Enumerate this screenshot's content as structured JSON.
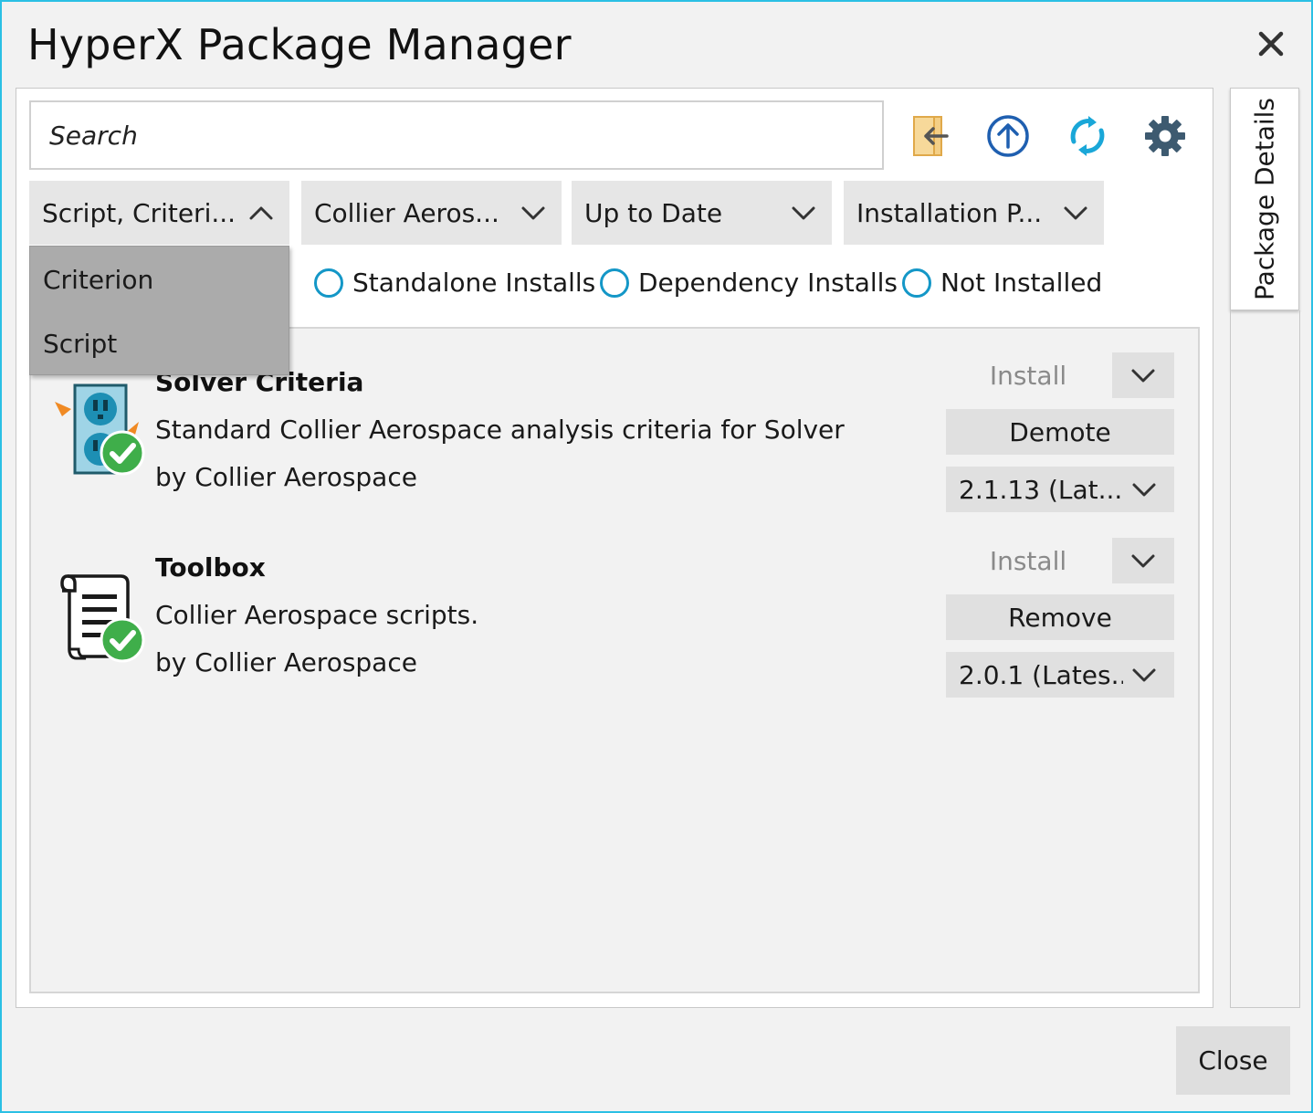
{
  "window": {
    "title": "HyperX Package Manager"
  },
  "search": {
    "placeholder": "Search"
  },
  "toolbar": {
    "icons": [
      "import-icon",
      "upload-icon",
      "refresh-icon",
      "settings-icon"
    ],
    "colors": {
      "import": "#f0c070",
      "upload": "#1f5fb0",
      "refresh": "#1aa7d8",
      "settings": "#3d5a70"
    }
  },
  "filters": {
    "type": "Script, Criteri...",
    "publisher": "Collier Aeros...",
    "status": "Up to Date",
    "installation": "Installation P..."
  },
  "type_dropdown": {
    "items": [
      "Criterion",
      "Script"
    ]
  },
  "radios": {
    "partial": ":",
    "standalone": "Standalone Installs",
    "dependency": "Dependency Installs",
    "not_installed": "Not Installed"
  },
  "packages": [
    {
      "name": "Solver Criteria",
      "description": "Standard Collier Aerospace analysis criteria for Solver",
      "author": "by Collier Aerospace",
      "install_label": "Install",
      "action_label": "Demote",
      "version": "2.1.13 (Lat...",
      "icon": "outlet-icon"
    },
    {
      "name": "Toolbox",
      "description": "Collier Aerospace scripts.",
      "author": "by Collier Aerospace",
      "install_label": "Install",
      "action_label": "Remove",
      "version": "2.0.1 (Lates...",
      "icon": "scroll-icon"
    }
  ],
  "side_panel": {
    "label": "Package Details"
  },
  "footer": {
    "close_label": "Close"
  },
  "colors": {
    "accent": "#2bc0e4",
    "radio": "#1497c7",
    "check": "#3fae4a"
  }
}
